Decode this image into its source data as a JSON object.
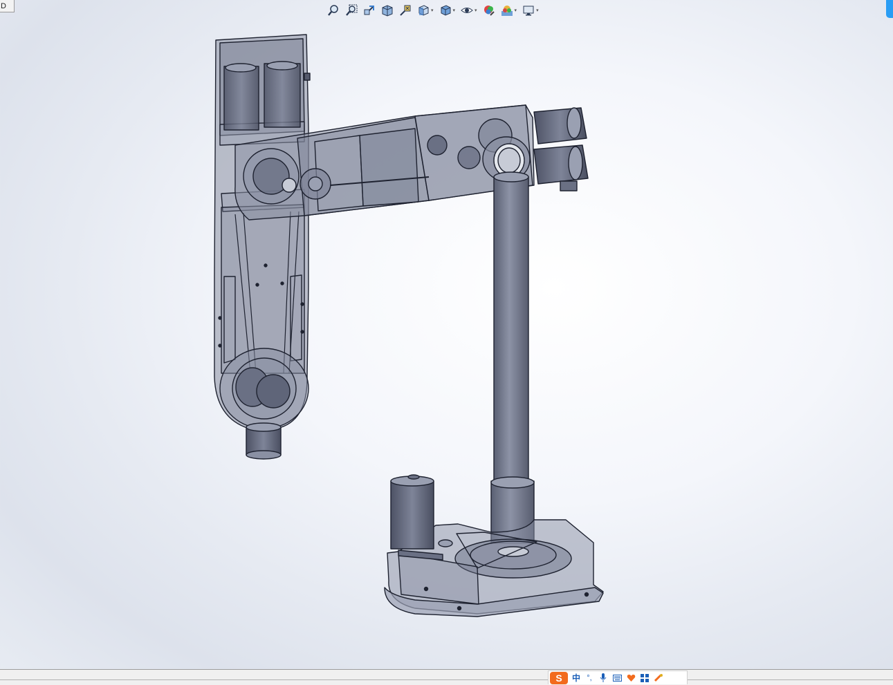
{
  "app": {
    "corner_tab_label": "D"
  },
  "toolbar": {
    "buttons": [
      {
        "name": "zoom-to-fit-icon"
      },
      {
        "name": "zoom-to-area-icon"
      },
      {
        "name": "previous-view-icon"
      },
      {
        "name": "section-view-icon"
      },
      {
        "name": "dynamic-annotation-icon"
      },
      {
        "name": "view-orientation-icon",
        "dropdown": true
      },
      {
        "name": "display-style-icon",
        "dropdown": true
      },
      {
        "name": "hide-show-items-icon",
        "dropdown": true
      },
      {
        "name": "edit-appearance-icon"
      },
      {
        "name": "apply-scene-icon",
        "dropdown": true
      },
      {
        "name": "view-settings-icon",
        "dropdown": true
      }
    ],
    "dropdown_glyph": "▾"
  },
  "viewport": {
    "model_description_icon": "robot-arm-assembly-icon",
    "colors": {
      "body_fill": "#6f7588",
      "body_stroke": "#1e2230",
      "transparent_fill": "#8a90a3"
    }
  },
  "taskbar": {
    "ime": {
      "logo_text": "S",
      "language_text": "中",
      "icons": [
        "punctuation-icon",
        "microphone-icon",
        "keyboard-icon",
        "skin-icon",
        "toolbox-icon",
        "settings-icon"
      ]
    }
  }
}
